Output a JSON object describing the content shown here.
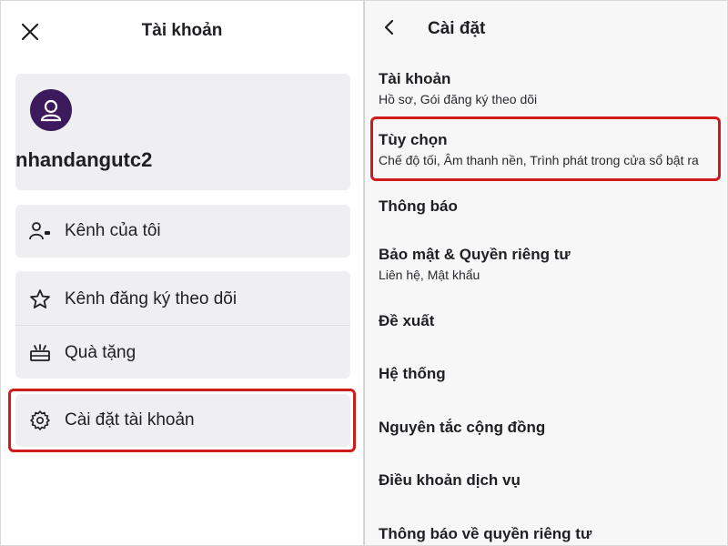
{
  "left": {
    "title": "Tài khoản",
    "username": "nhandangutc2",
    "menu": {
      "my_channel": "Kênh của tôi",
      "followed_channels": "Kênh đăng ký theo dõi",
      "gifts": "Quà tặng",
      "account_settings": "Cài đặt tài khoản"
    },
    "icons": {
      "close": "close-icon",
      "avatar": "user-avatar-icon",
      "my_channel": "person-channel-icon",
      "followed": "star-icon",
      "gifts": "gift-box-icon",
      "settings": "gear-icon"
    }
  },
  "right": {
    "title": "Cài đặt",
    "items": [
      {
        "title": "Tài khoản",
        "subtitle": "Hồ sơ, Gói đăng ký theo dõi"
      },
      {
        "title": "Tùy chọn",
        "subtitle": "Chế độ tối, Âm thanh nền, Trình phát trong cửa sổ bật ra"
      },
      {
        "title": "Thông báo",
        "subtitle": ""
      },
      {
        "title": "Bảo mật & Quyền riêng tư",
        "subtitle": "Liên hệ, Mật khẩu"
      },
      {
        "title": "Đề xuất",
        "subtitle": ""
      },
      {
        "title": "Hệ thống",
        "subtitle": ""
      },
      {
        "title": "Nguyên tắc cộng đồng",
        "subtitle": ""
      },
      {
        "title": "Điều khoản dịch vụ",
        "subtitle": ""
      },
      {
        "title": "Thông báo về quyền riêng tư",
        "subtitle": ""
      }
    ]
  },
  "colors": {
    "highlight": "#d11a1a",
    "avatar_bg": "#3d1a5b",
    "card_bg": "#efeff1"
  }
}
